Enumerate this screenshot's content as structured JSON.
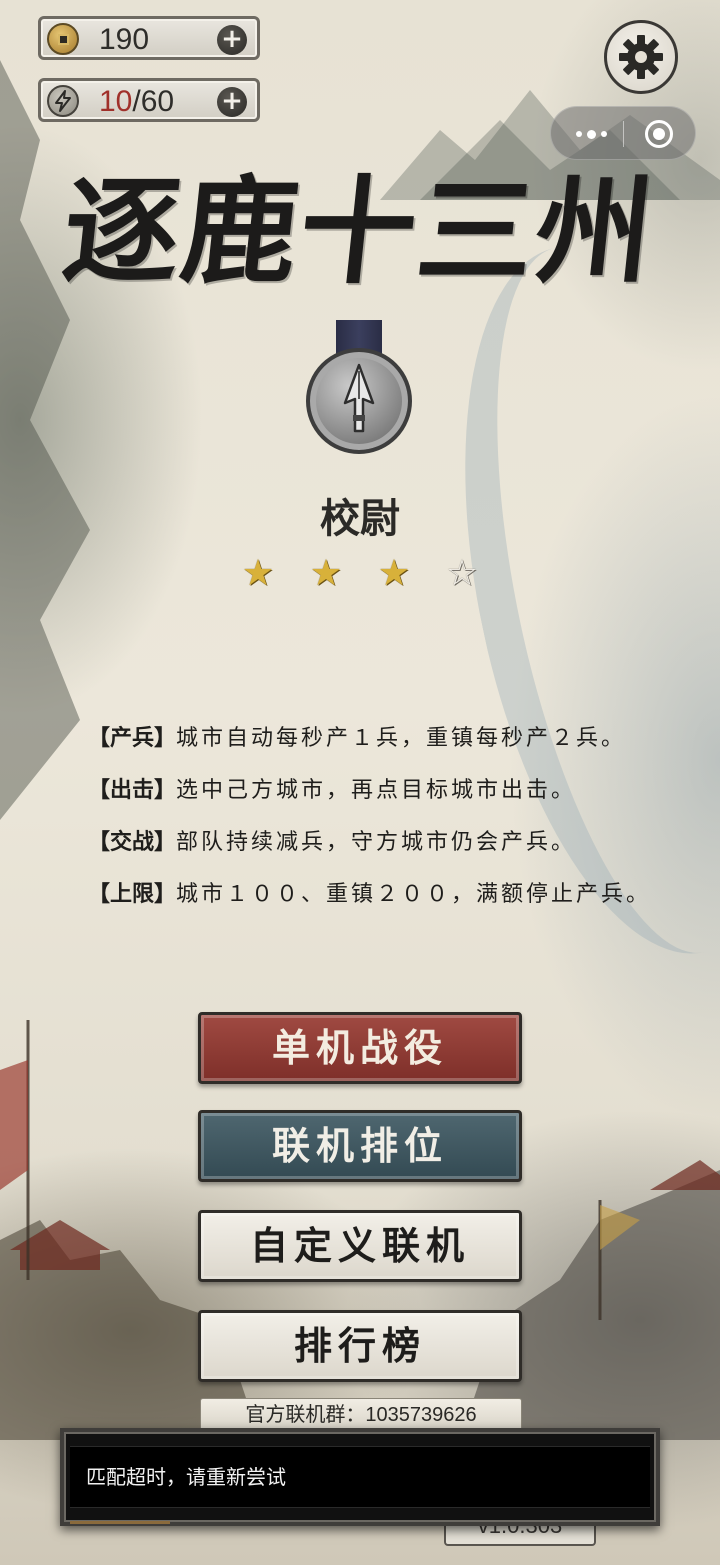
{
  "resources": {
    "coins": "190",
    "stamina_current": "10",
    "stamina_separator": "/",
    "stamina_max": "60",
    "add_symbol": "+"
  },
  "title": "逐鹿十三州",
  "rank": {
    "name": "校尉",
    "stars_filled": 3,
    "stars_total": 4,
    "star_filled_symbol": "★",
    "star_empty_symbol": "☆"
  },
  "rules": [
    {
      "tag": "【产兵】",
      "text": "城市自动每秒产１兵，重镇每秒产２兵。"
    },
    {
      "tag": "【出击】",
      "text": "选中己方城市，再点目标城市出击。"
    },
    {
      "tag": "【交战】",
      "text": "部队持续减兵，守方城市仍会产兵。"
    },
    {
      "tag": "【上限】",
      "text": "城市１００、重镇２００，满额停止产兵。"
    }
  ],
  "menu": {
    "single_player": "单机战役",
    "ranked_online": "联机排位",
    "custom_online": "自定义联机",
    "leaderboard": "排行榜"
  },
  "group_info": "官方联机群：1035739626",
  "version": "v1.0.303",
  "toast": {
    "message": "匹配超时，请重新尝试"
  },
  "colors": {
    "single_button": "#8f3c35",
    "ranked_button": "#405a63",
    "light_button": "#ebe7df",
    "star_gold": "#d8b13a"
  }
}
